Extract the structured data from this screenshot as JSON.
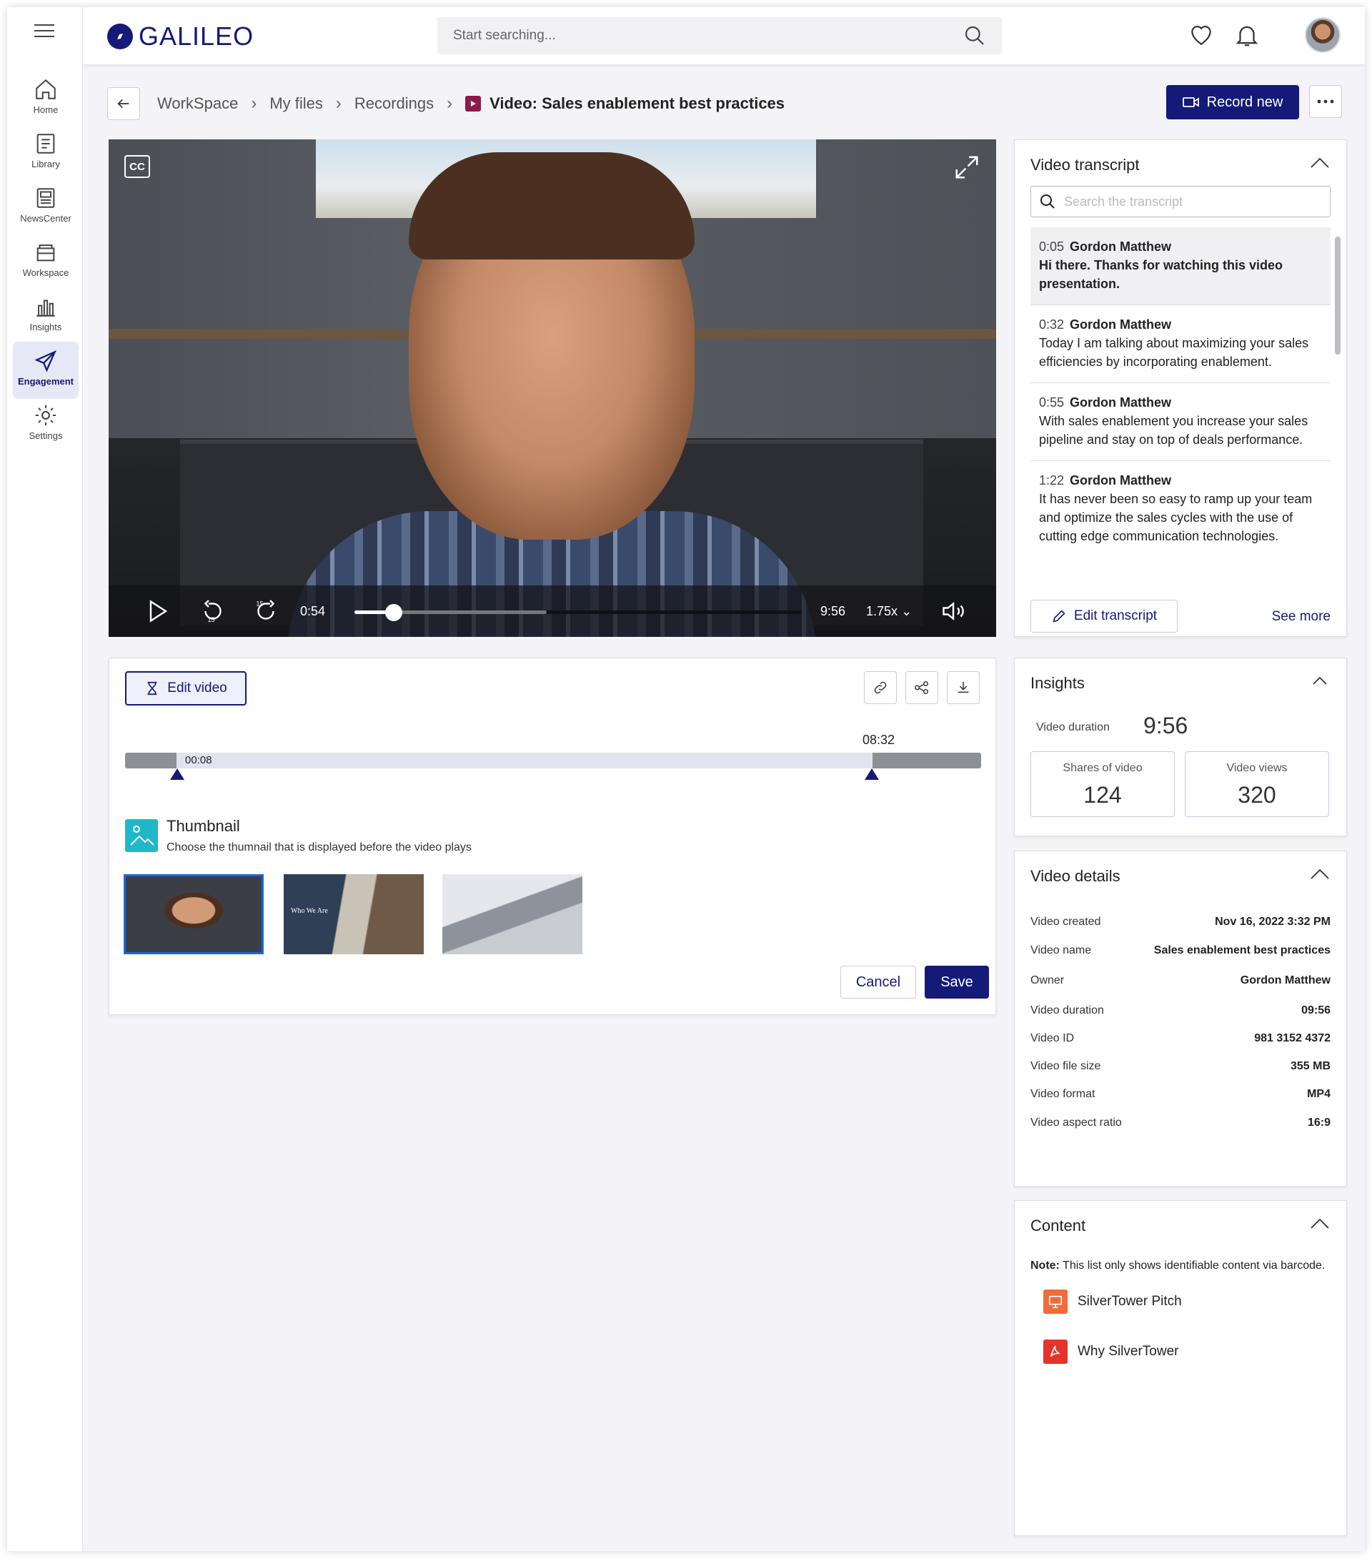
{
  "app": {
    "logo_text": "GALILEO",
    "accent": "#141a78"
  },
  "sidebar": {
    "items": [
      {
        "label": "Home",
        "icon": "home-icon"
      },
      {
        "label": "Library",
        "icon": "library-icon"
      },
      {
        "label": "NewsCenter",
        "icon": "newscenter-icon"
      },
      {
        "label": "Workspace",
        "icon": "workspace-icon"
      },
      {
        "label": "Insights",
        "icon": "insights-icon"
      },
      {
        "label": "Engagement",
        "icon": "engagement-icon",
        "active": true
      },
      {
        "label": "Settings",
        "icon": "settings-icon"
      }
    ]
  },
  "topbar": {
    "search_placeholder": "Start searching..."
  },
  "breadcrumb": {
    "items": [
      "WorkSpace",
      "My files",
      "Recordings"
    ],
    "current": "Video: Sales enablement best practices"
  },
  "actions": {
    "record_label": "Record new"
  },
  "player": {
    "cc_label": "CC",
    "current_time": "0:54",
    "duration": "9:56",
    "speed": "1.75x",
    "rewind_seconds": "15",
    "forward_seconds": "15",
    "progress_fraction": 0.095
  },
  "edit_panel": {
    "edit_label": "Edit video",
    "trim_start": "00:08",
    "trim_end": "08:32",
    "thumbnail_title": "Thumbnail",
    "thumbnail_subtitle": "Choose the thumnail that is displayed before the video plays",
    "thumb2_caption": "Who We Are",
    "cancel_label": "Cancel",
    "save_label": "Save"
  },
  "transcript": {
    "title": "Video transcript",
    "search_placeholder": "Search the transcript",
    "entries": [
      {
        "time": "0:05",
        "speaker": "Gordon Matthew",
        "text": "Hi there. Thanks for watching this video presentation."
      },
      {
        "time": "0:32",
        "speaker": "Gordon Matthew",
        "text": "Today I am talking about maximizing your sales efficiencies by incorporating enablement."
      },
      {
        "time": "0:55",
        "speaker": "Gordon Matthew",
        "text": "With sales enablement you increase your sales pipeline and stay on top of deals performance."
      },
      {
        "time": "1:22",
        "speaker": "Gordon Matthew",
        "text": "It has never been so easy to ramp up your team and optimize the sales cycles with the use of cutting edge communication technologies."
      }
    ],
    "edit_label": "Edit transcript",
    "see_more": "See more"
  },
  "insights": {
    "title": "Insights",
    "duration_label": "Video duration",
    "duration_value": "9:56",
    "shares_label": "Shares of  video",
    "shares_value": "124",
    "views_label": "Video views",
    "views_value": "320"
  },
  "details": {
    "title": "Video details",
    "rows": [
      {
        "k": "Video created",
        "v": "Nov 16, 2022 3:32 PM"
      },
      {
        "k": "Video name",
        "v": "Sales enablement best practices"
      },
      {
        "k": "Owner",
        "v": "Gordon Matthew"
      },
      {
        "k": "Video duration",
        "v": "09:56"
      },
      {
        "k": "Video ID",
        "v": "981 3152 4372"
      },
      {
        "k": "Video file size",
        "v": "355 MB"
      },
      {
        "k": "Video format",
        "v": "MP4"
      },
      {
        "k": "Video aspect ratio",
        "v": "16:9"
      }
    ]
  },
  "content": {
    "title": "Content",
    "note_bold": "Note:",
    "note_text": " This list only shows identifiable content via barcode.",
    "items": [
      {
        "label": "SilverTower Pitch",
        "icon": "presentation-icon",
        "color": "#f26b3a"
      },
      {
        "label": "Why SilverTower",
        "icon": "pdf-icon",
        "color": "#e2342b"
      }
    ]
  }
}
